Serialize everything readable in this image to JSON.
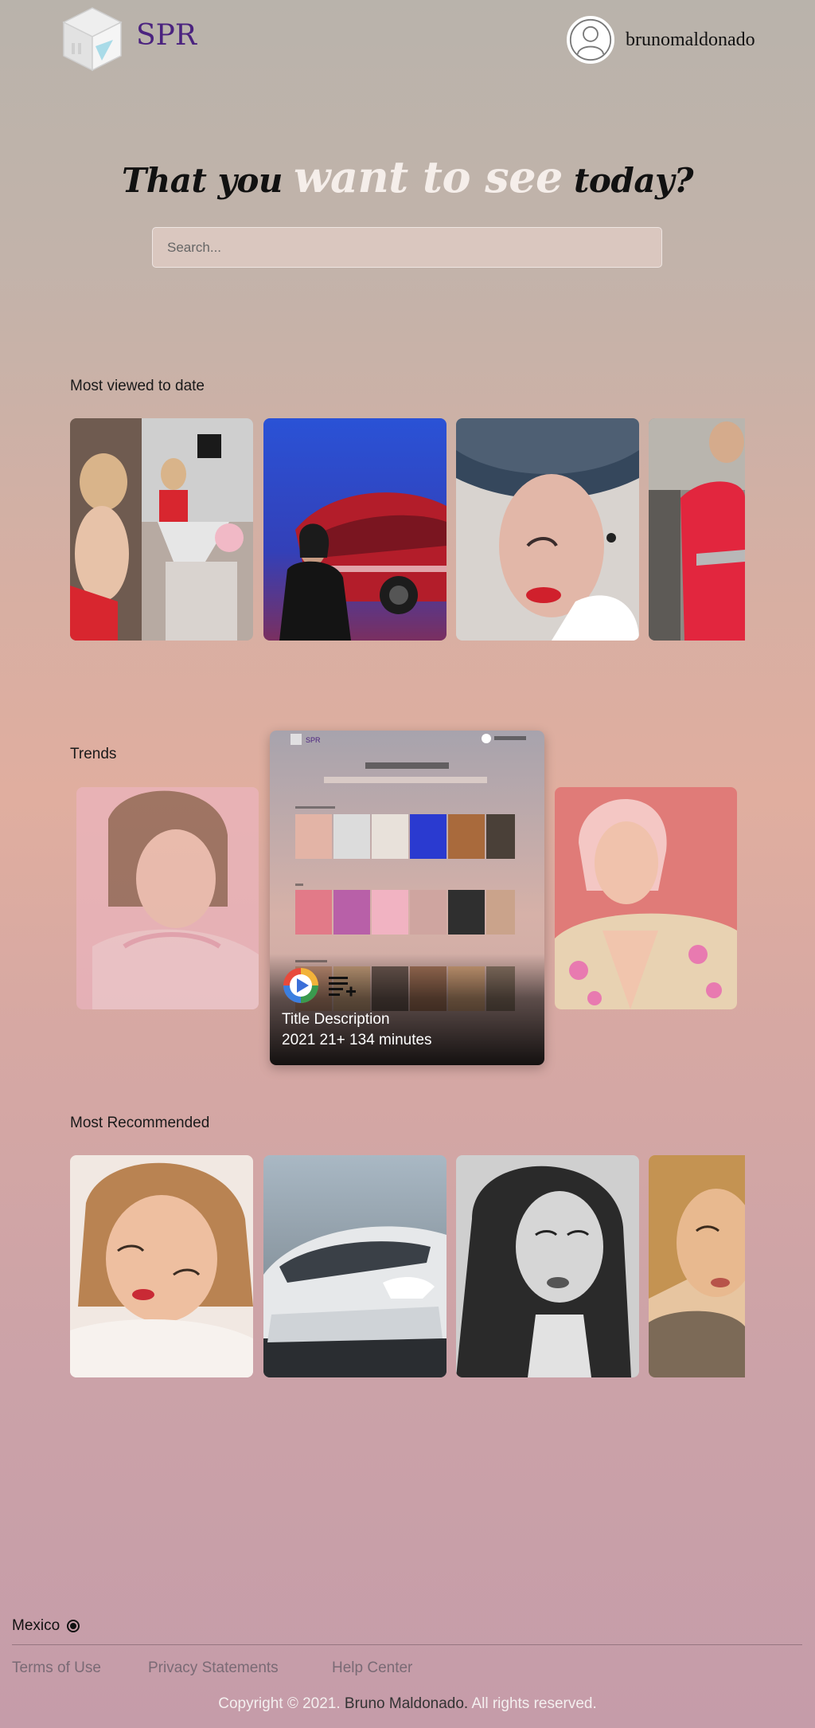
{
  "header": {
    "brand": "SPR",
    "username": "brunomaldonado"
  },
  "hero": {
    "title_start": "That you",
    "title_highlight": "want to see",
    "title_end": "today?"
  },
  "search": {
    "placeholder": "Search..."
  },
  "sections": [
    {
      "title": "Most viewed to date"
    },
    {
      "title": "Trends"
    },
    {
      "title": "Most Recommended"
    }
  ],
  "preview": {
    "title": "Title Description",
    "meta": "2021 21+ 134 minutes"
  },
  "footer": {
    "country": "Mexico",
    "links": [
      "Terms of Use",
      "Privacy Statements",
      "Help Center"
    ],
    "copyright_prefix": "Copyright © 2021.",
    "copyright_owner": "Bruno Maldonado.",
    "copyright_suffix": "All rights reserved."
  },
  "colors": {
    "brand": "#4b237f",
    "hero_highlight": "#f5eeea",
    "footer_link": "#7a6a75"
  },
  "icons": [
    "cube-logo-icon",
    "user-avatar-icon",
    "play-icon",
    "add-to-list-icon",
    "radio-selected-icon"
  ]
}
